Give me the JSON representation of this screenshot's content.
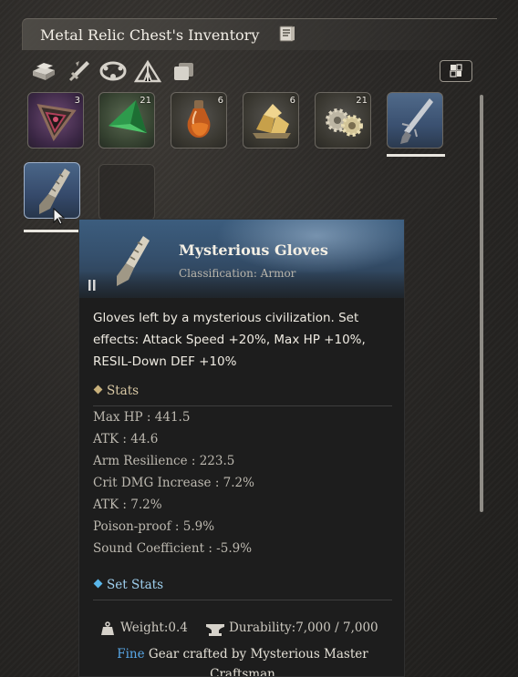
{
  "window": {
    "title": "Metal Relic Chest's Inventory",
    "title_icon": "book-icon",
    "layout_icon": "grid-view-icon"
  },
  "filters": [
    {
      "name": "filter-materials",
      "icon": "stacked-ingots-icon"
    },
    {
      "name": "filter-weapons",
      "icon": "crossed-swords-icon"
    },
    {
      "name": "filter-pets",
      "icon": "pet-collar-icon"
    },
    {
      "name": "filter-camp",
      "icon": "tent-icon"
    },
    {
      "name": "filter-all",
      "icon": "stacked-cards-icon"
    }
  ],
  "inventory": [
    {
      "name": "dark-triangle-relic",
      "count": "3",
      "icon": "triangle-relic-icon"
    },
    {
      "name": "green-pyramid-crystal",
      "count": "21",
      "icon": "green-crystal-icon"
    },
    {
      "name": "orange-potion",
      "count": "6",
      "icon": "potion-icon"
    },
    {
      "name": "gold-ore",
      "count": "6",
      "icon": "gold-ore-icon"
    },
    {
      "name": "metal-gears",
      "count": "21",
      "icon": "gears-icon"
    },
    {
      "name": "mysterious-blade",
      "count": "",
      "icon": "blade-icon",
      "equipped": true
    },
    {
      "name": "mysterious-gloves",
      "count": "",
      "icon": "gauntlet-icon",
      "equipped": true,
      "selected": true
    },
    {
      "name": "empty-slot",
      "count": "",
      "icon": ""
    }
  ],
  "tooltip": {
    "name": "Mysterious Gloves",
    "classification": "Classification: Armor",
    "description": "Gloves left by a mysterious civilization. Set effects: Attack Speed +20%, Max HP +10%, RESIL-Down DEF +10%",
    "stats_label": "Stats",
    "stats": [
      "Max HP : 441.5",
      "ATK : 44.6",
      "Arm Resilience : 223.5",
      "Crit DMG Increase : 7.2%",
      "ATK : 7.2%",
      "Poison-proof : 5.9%",
      "Sound Coefficient : -5.9%"
    ],
    "set_stats_label": "Set Stats",
    "weight": "Weight:0.4",
    "durability": "Durability:7,000 / 7,000",
    "grade": "Fine",
    "crafted_by": " Gear crafted by Mysterious Master Craftsman"
  },
  "colors": {
    "grade_fine": "#59a8e8",
    "stats_accent": "#c8b07a",
    "set_stats_accent": "#59b6ea"
  }
}
